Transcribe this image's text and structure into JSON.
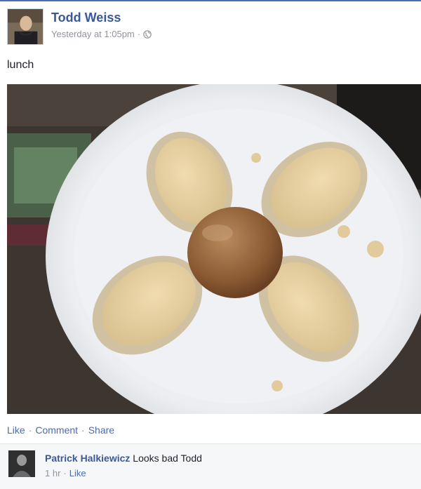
{
  "post": {
    "author": "Todd Weiss",
    "timestamp": "Yesterday at 1:05pm",
    "separator": "·",
    "privacy_icon": "globe-icon",
    "text": "lunch"
  },
  "actions": {
    "like": "Like",
    "comment": "Comment",
    "share": "Share",
    "separator": "·"
  },
  "comment": {
    "author": "Patrick Halkiewicz",
    "text": "Looks bad Todd",
    "time": "1 hr",
    "separator": "·",
    "like": "Like"
  },
  "colors": {
    "link_blue": "#3b5998",
    "action_blue": "#4b6bb0",
    "muted_gray": "#90949c",
    "comment_bg": "#f6f7f9"
  }
}
